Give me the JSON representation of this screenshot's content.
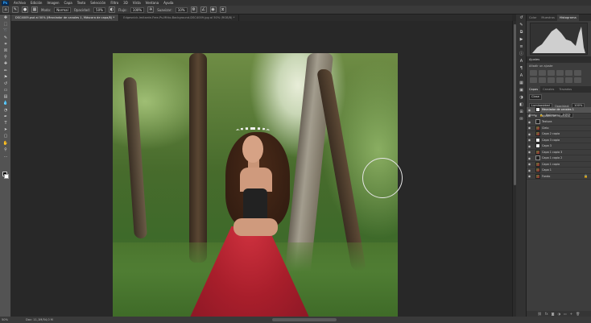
{
  "app": {
    "logo": "Ps"
  },
  "menu": [
    "Archivo",
    "Edición",
    "Imagen",
    "Capa",
    "Texto",
    "Selección",
    "Filtro",
    "3D",
    "Vista",
    "Ventana",
    "Ayuda"
  ],
  "options_bar": {
    "mode_label": "Modo:",
    "mode_value": "Normal",
    "opacity_label": "Opacidad:",
    "opacity_value": "50%",
    "flow_label": "Flujo:",
    "flow_value": "100%",
    "smoothing_label": "Suavizar:",
    "smoothing_value": "10%"
  },
  "tabs": [
    {
      "label": "DSC4009.psd al 50% (Mezclador de canales 1, Máscara de capa/8) *",
      "active": true
    },
    {
      "label": "Edgesnick-Imitarde-Free-Ps-Mitto-Background-DSC4009.jpg al 50% (RGB/8) *",
      "active": false
    }
  ],
  "status": {
    "zoom": "50%",
    "doc": "Doc: 11,1M/54,0 M"
  },
  "panel_tabs": [
    {
      "label": "Color",
      "active": false
    },
    {
      "label": "Muestras",
      "active": false
    },
    {
      "label": "Histograma",
      "active": true
    }
  ],
  "adjustments": {
    "title": "Ajustes",
    "hint": "Añadir un ajuste"
  },
  "layers_tabs": [
    {
      "label": "Capas",
      "active": true
    },
    {
      "label": "Canales",
      "active": false
    },
    {
      "label": "Trazados",
      "active": false
    }
  ],
  "layers_controls": {
    "kind": "Clase",
    "blend": "Luminosidad",
    "opacity_label": "Opacidad:",
    "opacity_value": "100%",
    "lock_label": "Bloq.:",
    "fill_label": "Relleno:",
    "fill_value": "100%"
  },
  "layers": [
    {
      "name": "Mezclador de canales 1",
      "thumb": "white",
      "selected": true
    },
    {
      "name": "ajustes de Pincelada",
      "thumb": "folder",
      "selected": false
    },
    {
      "name": "Textura",
      "thumb": "dark",
      "selected": false
    },
    {
      "name": "Cielo",
      "thumb": "img",
      "selected": false
    },
    {
      "name": "Capa 2 copia",
      "thumb": "img",
      "selected": false
    },
    {
      "name": "Capa 3 copia",
      "thumb": "white",
      "selected": false
    },
    {
      "name": "Capa 3",
      "thumb": "white",
      "selected": false
    },
    {
      "name": "Capa 1 copia 3",
      "thumb": "img",
      "selected": false
    },
    {
      "name": "Capa 1 copia 2",
      "thumb": "dark",
      "selected": false
    },
    {
      "name": "Capa 1 copia",
      "thumb": "img",
      "selected": false
    },
    {
      "name": "Capa 1",
      "thumb": "img",
      "selected": false
    },
    {
      "name": "Fondo",
      "thumb": "img",
      "selected": false
    }
  ]
}
